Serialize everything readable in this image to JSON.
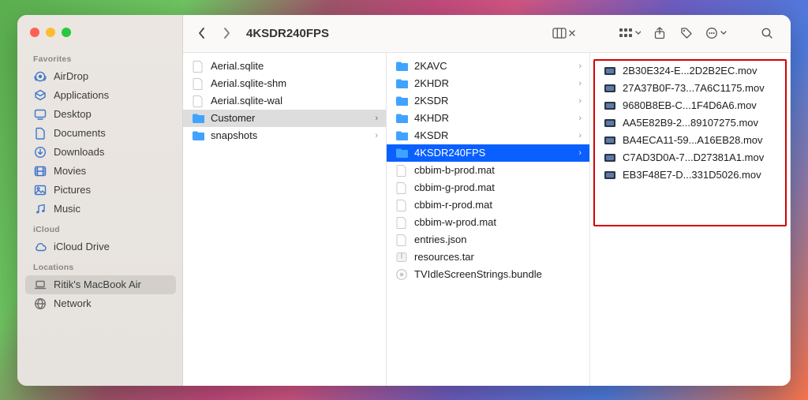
{
  "window": {
    "title": "4KSDR240FPS"
  },
  "sidebar": {
    "sections": [
      {
        "label": "Favorites",
        "items": [
          {
            "name": "AirDrop",
            "icon": "airdrop"
          },
          {
            "name": "Applications",
            "icon": "apps"
          },
          {
            "name": "Desktop",
            "icon": "desktop"
          },
          {
            "name": "Documents",
            "icon": "doc"
          },
          {
            "name": "Downloads",
            "icon": "download"
          },
          {
            "name": "Movies",
            "icon": "movies"
          },
          {
            "name": "Pictures",
            "icon": "pictures"
          },
          {
            "name": "Music",
            "icon": "music"
          }
        ]
      },
      {
        "label": "iCloud",
        "items": [
          {
            "name": "iCloud Drive",
            "icon": "cloud"
          }
        ]
      },
      {
        "label": "Locations",
        "items": [
          {
            "name": "Ritik's MacBook Air",
            "icon": "laptop",
            "selected": true
          },
          {
            "name": "Network",
            "icon": "globe"
          }
        ]
      }
    ]
  },
  "columns": {
    "col1": [
      {
        "name": "Aerial.sqlite",
        "kind": "file"
      },
      {
        "name": "Aerial.sqlite-shm",
        "kind": "file"
      },
      {
        "name": "Aerial.sqlite-wal",
        "kind": "file"
      },
      {
        "name": "Customer",
        "kind": "folder",
        "selected": "light",
        "drill": true
      },
      {
        "name": "snapshots",
        "kind": "folder"
      }
    ],
    "col2": [
      {
        "name": "2KAVC",
        "kind": "folder"
      },
      {
        "name": "2KHDR",
        "kind": "folder"
      },
      {
        "name": "2KSDR",
        "kind": "folder"
      },
      {
        "name": "4KHDR",
        "kind": "folder"
      },
      {
        "name": "4KSDR",
        "kind": "folder"
      },
      {
        "name": "4KSDR240FPS",
        "kind": "folder",
        "selected": "blue",
        "drill": true
      },
      {
        "name": "cbbim-b-prod.mat",
        "kind": "file"
      },
      {
        "name": "cbbim-g-prod.mat",
        "kind": "file"
      },
      {
        "name": "cbbim-r-prod.mat",
        "kind": "file"
      },
      {
        "name": "cbbim-w-prod.mat",
        "kind": "file"
      },
      {
        "name": "entries.json",
        "kind": "file"
      },
      {
        "name": "resources.tar",
        "kind": "archive"
      },
      {
        "name": "TVIdleScreenStrings.bundle",
        "kind": "bundle"
      }
    ],
    "col3": [
      {
        "name": "2B30E324-E...2D2B2EC.mov",
        "kind": "video"
      },
      {
        "name": "27A37B0F-73...7A6C1175.mov",
        "kind": "video"
      },
      {
        "name": "9680B8EB-C...1F4D6A6.mov",
        "kind": "video"
      },
      {
        "name": "AA5E82B9-2...89107275.mov",
        "kind": "video"
      },
      {
        "name": "BA4ECA11-59...A16EB28.mov",
        "kind": "video"
      },
      {
        "name": "C7AD3D0A-7...D27381A1.mov",
        "kind": "video"
      },
      {
        "name": "EB3F48E7-D...331D5026.mov",
        "kind": "video"
      }
    ]
  },
  "toolbar": {
    "back_enabled": true,
    "forward_enabled": false,
    "view": "columns"
  }
}
